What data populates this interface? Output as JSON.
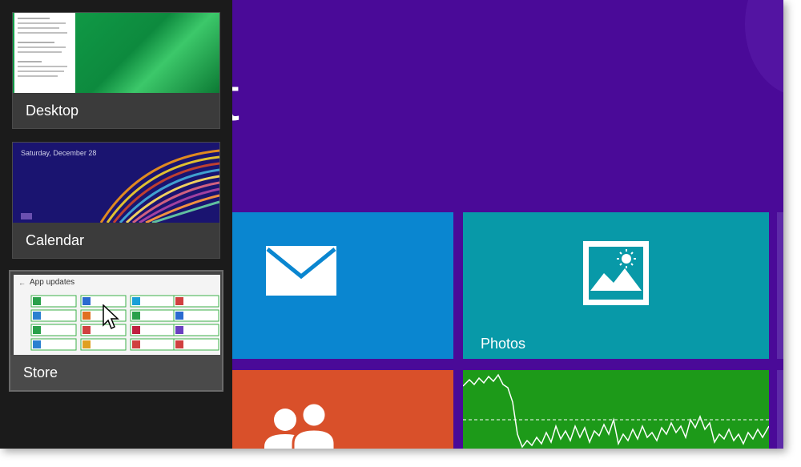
{
  "switcher": {
    "items": [
      {
        "label": "Desktop"
      },
      {
        "label": "Calendar",
        "date_text": "Saturday, December 28"
      },
      {
        "label": "Store",
        "header_text": "App updates"
      }
    ]
  },
  "start": {
    "title_fragment": "rt",
    "tiles": [
      {
        "name": "Mail",
        "label": "",
        "color": "#0a86d0"
      },
      {
        "name": "Photos",
        "label": "Photos",
        "color": "#0899a8"
      },
      {
        "name": "People",
        "label": "",
        "color": "#d9502a"
      },
      {
        "name": "Finance",
        "label": "",
        "color": "#1d9a19"
      }
    ]
  },
  "colors": {
    "start_background": "#4a0a98",
    "switcher_background": "#1b1b1b"
  }
}
